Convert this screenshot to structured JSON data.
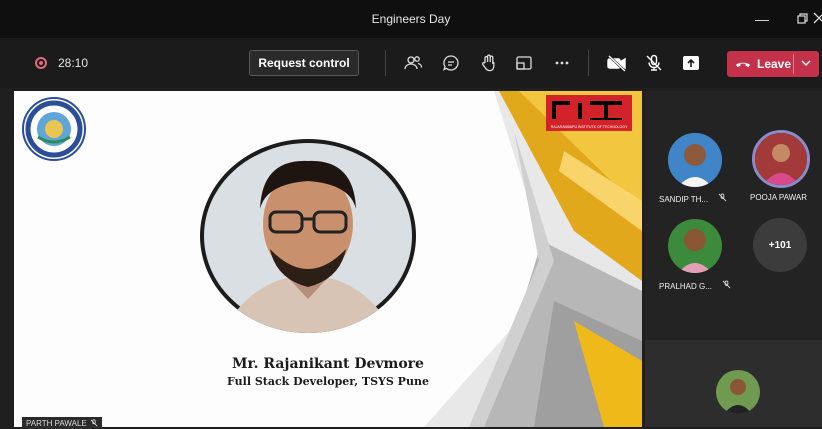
{
  "window": {
    "title": "Engineers Day"
  },
  "toolbar": {
    "timer": "28:10",
    "request_control_label": "Request control",
    "leave_label": "Leave"
  },
  "slide": {
    "logo_text": "rit",
    "logo_caption": "RAJARAMBAPU INSTITUTE OF TECHNOLOGY",
    "speaker_name": "Mr. Rajanikant Devmore",
    "speaker_role": "Full Stack Developer, TSYS Pune"
  },
  "participants": [
    {
      "name": "SANDIP TH...",
      "muted": true
    },
    {
      "name": "POOJA PAWAR",
      "muted": false
    },
    {
      "name": "PRALHAD G...",
      "muted": true
    }
  ],
  "overflow_count": "+101",
  "presenter_label": "PARTH PAWALE",
  "colors": {
    "leave_red": "#c4314b",
    "accent_yellow": "#f2b705",
    "rit_red": "#d2232a"
  }
}
